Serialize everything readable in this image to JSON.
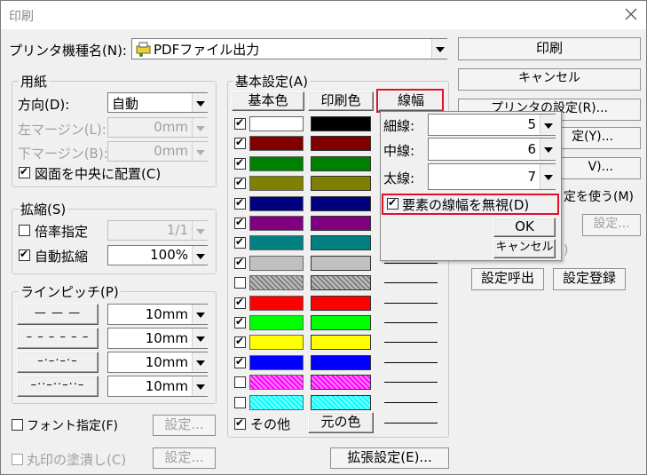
{
  "window": {
    "title": "印刷"
  },
  "printer": {
    "label": "プリンタ機種名(N):",
    "value": "PDFファイル出力"
  },
  "right_buttons": {
    "print": "印刷",
    "cancel": "キャンセル",
    "printer_settings": "プリンタの設定(R)...",
    "y_partial": "定(Y)...",
    "v_partial": "V)...",
    "use_partial": "定を使う(M)",
    "settings_disabled": "設定...",
    "q_partial": ")",
    "load": "設定呼出",
    "save": "設定登録"
  },
  "paper": {
    "legend": "用紙",
    "direction_label": "方向(D):",
    "direction_value": "自動",
    "left_margin_label": "左マージン(L):",
    "left_margin_value": "0mm",
    "bottom_margin_label": "下マージン(B):",
    "bottom_margin_value": "0mm",
    "center_label": "図面を中央に配置(C)",
    "center_checked": true
  },
  "scale": {
    "legend": "拡縮(S)",
    "ratio_label": "倍率指定",
    "ratio_value": "1/1",
    "ratio_checked": false,
    "auto_label": "自動拡縮",
    "auto_value": "100%",
    "auto_checked": true
  },
  "pitch": {
    "legend": "ラインピッチ(P)",
    "rows": [
      {
        "pattern": "— — —",
        "value": "10mm"
      },
      {
        "pattern": "– – – – – –",
        "value": "10mm"
      },
      {
        "pattern": "–·–·–·–",
        "value": "10mm"
      },
      {
        "pattern": "–··–··–··–",
        "value": "10mm"
      }
    ]
  },
  "font": {
    "label": "フォント指定(F)",
    "checked": false,
    "button": "設定..."
  },
  "stamp": {
    "label": "丸印の塗潰し(C)",
    "checked": false,
    "button": "設定..."
  },
  "basic": {
    "legend": "基本設定(A)",
    "col_base": "基本色",
    "col_print": "印刷色",
    "col_width": "線幅",
    "rows": [
      {
        "checked": true,
        "base": "#ffffff",
        "print": "#000000",
        "hatch": false
      },
      {
        "checked": true,
        "base": "#800000",
        "print": "#800000",
        "hatch": false
      },
      {
        "checked": true,
        "base": "#008000",
        "print": "#008000",
        "hatch": false
      },
      {
        "checked": true,
        "base": "#808000",
        "print": "#808000",
        "hatch": false
      },
      {
        "checked": true,
        "base": "#000080",
        "print": "#000080",
        "hatch": false
      },
      {
        "checked": true,
        "base": "#800080",
        "print": "#800080",
        "hatch": false
      },
      {
        "checked": true,
        "base": "#008080",
        "print": "#008080",
        "hatch": false
      },
      {
        "checked": true,
        "base": "#c0c0c0",
        "print": "#c0c0c0",
        "hatch": false
      },
      {
        "checked": false,
        "base": "#808080",
        "print": "#808080",
        "hatch": true
      },
      {
        "checked": true,
        "base": "#ff0000",
        "print": "#ff0000",
        "hatch": false
      },
      {
        "checked": true,
        "base": "#00ff00",
        "print": "#00ff00",
        "hatch": false
      },
      {
        "checked": true,
        "base": "#ffff00",
        "print": "#ffff00",
        "hatch": false
      },
      {
        "checked": true,
        "base": "#0000ff",
        "print": "#0000ff",
        "hatch": false
      },
      {
        "checked": false,
        "base": "#ff00ff",
        "print": "#ff00ff",
        "hatch": true
      },
      {
        "checked": false,
        "base": "#00ffff",
        "print": "#00ffff",
        "hatch": true
      }
    ],
    "other_label": "その他",
    "other_checked": true,
    "orig_color": "元の色",
    "ext_button": "拡張設定(E)..."
  },
  "popup": {
    "thin_label": "細線:",
    "thin_value": "5",
    "mid_label": "中線:",
    "mid_value": "6",
    "thick_label": "太線:",
    "thick_value": "7",
    "ignore_label": "要素の線幅を無視(D)",
    "ignore_checked": true,
    "ok": "OK",
    "cancel": "キャンセル"
  },
  "colors": {
    "highlight": "#e0102a",
    "dialog_bg": "#f0f0f0"
  }
}
